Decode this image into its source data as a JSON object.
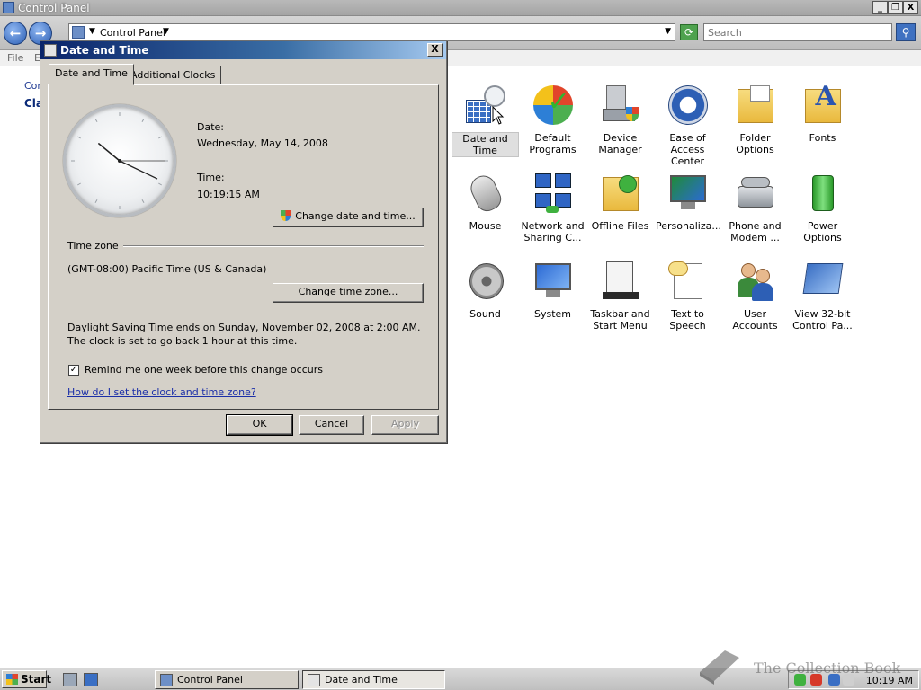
{
  "window": {
    "title": "Control Panel",
    "controls": {
      "minimize": "_",
      "maximize": "❐",
      "close": "X"
    }
  },
  "address": {
    "location": "Control Panel",
    "search_placeholder": "Search"
  },
  "menubar": {
    "file": "File",
    "edit": "E"
  },
  "left_pane": {
    "link1": "Con",
    "link2": "Cla"
  },
  "items": [
    {
      "label": "Date and Time",
      "icon": "date-time-icon"
    },
    {
      "label": "Default Programs",
      "icon": "default-programs-icon"
    },
    {
      "label": "Device Manager",
      "icon": "device-manager-icon"
    },
    {
      "label": "Ease of Access Center",
      "icon": "ease-of-access-icon"
    },
    {
      "label": "Folder Options",
      "icon": "folder-options-icon"
    },
    {
      "label": "Fonts",
      "icon": "fonts-icon"
    },
    {
      "label": "Mouse",
      "icon": "mouse-icon"
    },
    {
      "label": "Network and Sharing C...",
      "icon": "network-icon"
    },
    {
      "label": "Offline Files",
      "icon": "offline-files-icon"
    },
    {
      "label": "Personaliza...",
      "icon": "personalization-icon"
    },
    {
      "label": "Phone and Modem ...",
      "icon": "phone-modem-icon"
    },
    {
      "label": "Power Options",
      "icon": "power-options-icon"
    },
    {
      "label": "Sound",
      "icon": "sound-icon"
    },
    {
      "label": "System",
      "icon": "system-icon"
    },
    {
      "label": "Taskbar and Start Menu",
      "icon": "taskbar-icon"
    },
    {
      "label": "Text to Speech",
      "icon": "text-to-speech-icon"
    },
    {
      "label": "User Accounts",
      "icon": "user-accounts-icon"
    },
    {
      "label": "View 32-bit Control Pa...",
      "icon": "control-panel-32-icon"
    }
  ],
  "dialog": {
    "title": "Date and Time",
    "close": "X",
    "tabs": [
      "Date and Time",
      "Additional Clocks"
    ],
    "date_label": "Date:",
    "date_value": "Wednesday, May 14, 2008",
    "time_label": "Time:",
    "time_value": "10:19:15 AM",
    "change_datetime_button": "Change date and time...",
    "timezone_heading": "Time zone",
    "timezone_value": "(GMT-08:00) Pacific Time (US & Canada)",
    "change_timezone_button": "Change time zone...",
    "dst_text": "Daylight Saving Time ends on Sunday, November 02, 2008 at 2:00 AM. The clock is set to go back 1 hour at this time.",
    "remind_label": "Remind me one week before this change occurs",
    "remind_checked": true,
    "help_link": "How do I set the clock and time zone?",
    "ok": "OK",
    "cancel": "Cancel",
    "apply": "Apply"
  },
  "clock": {
    "hours": 10,
    "minutes": 19,
    "seconds": 15
  },
  "taskbar": {
    "start": "Start",
    "tasks": [
      "Control Panel",
      "Date and Time"
    ],
    "clock": "10:19 AM"
  },
  "watermark": "The Collection Book"
}
